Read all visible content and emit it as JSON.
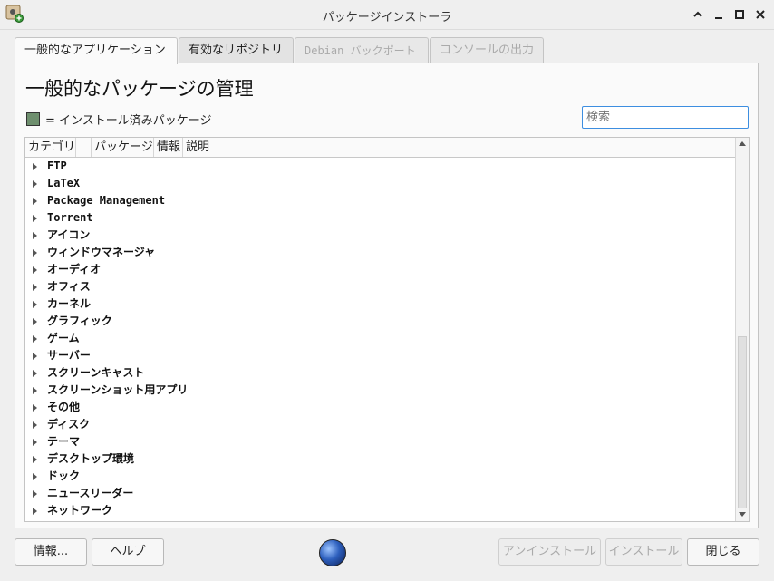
{
  "window": {
    "title": "パッケージインストーラ",
    "controls": [
      "chevron-up-icon",
      "minimize-icon",
      "maximize-icon",
      "close-icon"
    ]
  },
  "tabs": [
    {
      "label": "一般的なアプリケーション",
      "state": "active"
    },
    {
      "label": "有効なリポジトリ",
      "state": "normal"
    },
    {
      "label": "Debian バックポート",
      "state": "disabled"
    },
    {
      "label": "コンソールの出力",
      "state": "disabled"
    }
  ],
  "main": {
    "heading": "一般的なパッケージの管理",
    "legend_text": "= インストール済みパッケージ",
    "legend_color": "#6e8f6e",
    "search": {
      "value": "",
      "placeholder": "検索"
    }
  },
  "tree": {
    "columns": [
      "カテゴリ",
      "",
      "パッケージ",
      "情報",
      "説明"
    ],
    "rows": [
      "FTP",
      "LaTeX",
      "Package Management",
      "Torrent",
      "アイコン",
      "ウィンドウマネージャ",
      "オーディオ",
      "オフィス",
      "カーネル",
      "グラフィック",
      "ゲーム",
      "サーバー",
      "スクリーンキャスト",
      "スクリーンショット用アプリ",
      "その他",
      "ディスク",
      "テーマ",
      "デスクトップ環境",
      "ドック",
      "ニュースリーダー",
      "ネットワーク"
    ],
    "scroll_fraction": 0.48
  },
  "footer": {
    "info_label": "情報...",
    "help_label": "ヘルプ",
    "uninstall_label": "アンインストール",
    "install_label": "インストール",
    "close_label": "閉じる"
  }
}
